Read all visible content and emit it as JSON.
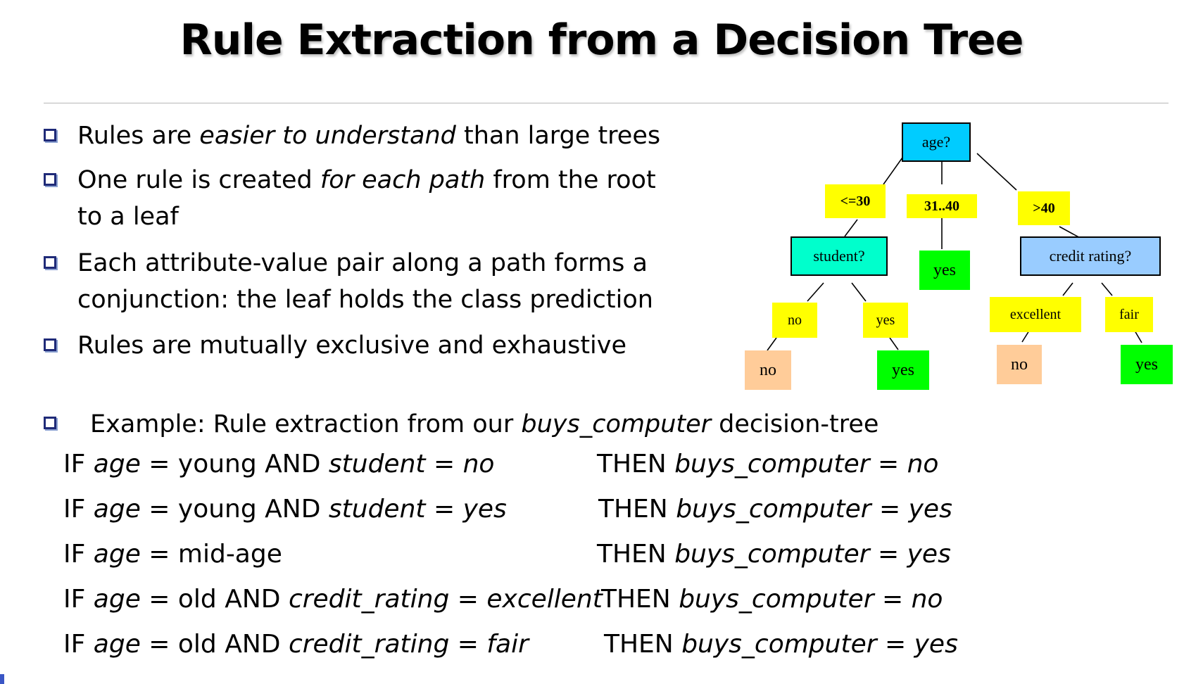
{
  "title": "Rule Extraction from a Decision Tree",
  "bullets": [
    {
      "pre": "Rules are ",
      "em": "easier to understand",
      "post": " than large trees"
    },
    {
      "pre": "One rule is created ",
      "em": "for each path",
      "post": " from the root",
      "line2": "to a leaf"
    },
    {
      "line1": "Each attribute-value pair along a path forms a",
      "line2": "conjunction: the leaf holds the class prediction"
    },
    {
      "text": "Rules are mutually exclusive and exhaustive"
    }
  ],
  "example": {
    "pre": "Example: Rule extraction from our ",
    "em": "buys_computer",
    "post": " decision-tree"
  },
  "rules": [
    {
      "cond": [
        "IF ",
        "age",
        " = young AND ",
        "student",
        " = ",
        "no"
      ],
      "then": [
        "THEN ",
        "buys_computer",
        " = ",
        "no"
      ]
    },
    {
      "cond": [
        "IF ",
        "age",
        " = young AND ",
        "student",
        " = ",
        "yes"
      ],
      "then": [
        "THEN ",
        "buys_computer",
        " = ",
        "yes"
      ]
    },
    {
      "cond": [
        "IF ",
        "age",
        " = mid-age",
        "",
        "",
        ""
      ],
      "then": [
        "THEN ",
        "buys_computer",
        " = ",
        "yes"
      ]
    },
    {
      "cond": [
        "IF ",
        "age",
        " = old AND ",
        "credit_rating",
        " = ",
        "excellent"
      ],
      "then": [
        "THEN ",
        "buys_computer",
        " = ",
        "no"
      ]
    },
    {
      "cond": [
        "IF ",
        "age",
        " = old AND ",
        "credit_rating",
        " = ",
        "fair"
      ],
      "then": [
        "THEN ",
        "buys_computer",
        " = ",
        "yes"
      ]
    }
  ],
  "tree": {
    "root": "age?",
    "branches": [
      "<=30",
      "31..40",
      ">40"
    ],
    "student_node": "student?",
    "credit_node": "credit rating?",
    "mid_leaf": "yes",
    "student_branches": [
      "no",
      "yes"
    ],
    "student_leaves": [
      "no",
      "yes"
    ],
    "credit_branches": [
      "excellent",
      "fair"
    ],
    "credit_leaves": [
      "no",
      "yes"
    ],
    "colors": {
      "root": "#00ccff",
      "student": "#00ffcc",
      "credit": "#99ccff",
      "edge": "#ffff00",
      "leaf_yes": "#00ff00",
      "leaf_no": "#ffcc99"
    }
  }
}
